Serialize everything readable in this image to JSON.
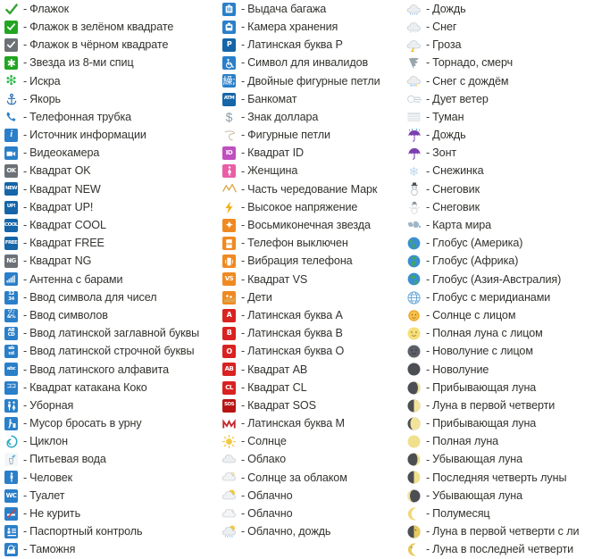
{
  "page": {
    "title": "Emoji reference list (Russian)",
    "text_color": "#32322e",
    "background": "#ffffff",
    "columns": 3
  },
  "columns": [
    {
      "id": "column-1",
      "rows": [
        {
          "icon": "check-mark-icon",
          "dash": "-",
          "label": "Флажок"
        },
        {
          "icon": "white-heavy-check-mark-icon",
          "dash": "-",
          "label": "Флажок в зелёном квадрате"
        },
        {
          "icon": "ballot-box-with-check-icon",
          "dash": "-",
          "label": "Флажок в чёрном квадрате"
        },
        {
          "icon": "eight-spoked-asterisk-icon",
          "dash": "-",
          "label": "Звезда из 8-ми спиц"
        },
        {
          "icon": "sparkle-icon",
          "dash": "-",
          "label": "Искра"
        },
        {
          "icon": "anchor-icon",
          "dash": "-",
          "label": "Якорь"
        },
        {
          "icon": "telephone-receiver-icon",
          "dash": "-",
          "label": "Телефонная трубка"
        },
        {
          "icon": "information-source-icon",
          "dash": "-",
          "label": "Источник информации"
        },
        {
          "icon": "video-camera-icon",
          "dash": "-",
          "label": "Видеокамера"
        },
        {
          "icon": "squared-ok-icon",
          "dash": "-",
          "label": "Квадрат OK"
        },
        {
          "icon": "squared-new-icon",
          "dash": "-",
          "label": "Квадрат NEW"
        },
        {
          "icon": "squared-up-icon",
          "dash": "-",
          "label": "Квадрат UP!"
        },
        {
          "icon": "squared-cool-icon",
          "dash": "-",
          "label": "Квадрат COOL"
        },
        {
          "icon": "squared-free-icon",
          "dash": "-",
          "label": "Квадрат FREE"
        },
        {
          "icon": "squared-ng-icon",
          "dash": "-",
          "label": "Квадрат NG"
        },
        {
          "icon": "antenna-with-bars-icon",
          "dash": "-",
          "label": "Антенна с барами"
        },
        {
          "icon": "input-numbers-icon",
          "dash": "-",
          "label": "Ввод символа для чисел"
        },
        {
          "icon": "input-symbols-icon",
          "dash": "-",
          "label": "Ввод символов"
        },
        {
          "icon": "input-latin-uppercase-icon",
          "dash": "-",
          "label": "Ввод латинской заглавной буквы"
        },
        {
          "icon": "input-latin-lowercase-icon",
          "dash": "-",
          "label": "Ввод латинской строчной буквы"
        },
        {
          "icon": "input-latin-letters-icon",
          "dash": "-",
          "label": "Ввод латинского алфавита"
        },
        {
          "icon": "squared-katakana-koko-icon",
          "dash": "-",
          "label": "Квадрат катакана Коко"
        },
        {
          "icon": "restroom-icon",
          "dash": "-",
          "label": "Уборная"
        },
        {
          "icon": "put-litter-in-bin-icon",
          "dash": "-",
          "label": "Мусор бросать в урну"
        },
        {
          "icon": "cyclone-icon",
          "dash": "-",
          "label": "Циклон"
        },
        {
          "icon": "potable-water-icon",
          "dash": "-",
          "label": "Питьевая вода"
        },
        {
          "icon": "pedestrian-icon",
          "dash": "-",
          "label": "Человек"
        },
        {
          "icon": "water-closet-icon",
          "dash": "-",
          "label": "Туалет"
        },
        {
          "icon": "no-smoking-icon",
          "dash": "-",
          "label": "Не курить"
        },
        {
          "icon": "passport-control-icon",
          "dash": "-",
          "label": "Паспортный контроль"
        },
        {
          "icon": "customs-icon",
          "dash": "-",
          "label": "Таможня"
        }
      ]
    },
    {
      "id": "column-2",
      "rows": [
        {
          "icon": "baggage-claim-icon",
          "dash": "-",
          "label": "Выдача багажа"
        },
        {
          "icon": "left-luggage-icon",
          "dash": "-",
          "label": "Камера хранения"
        },
        {
          "icon": "negative-squared-latin-p-icon",
          "dash": "-",
          "label": "Латинская буква P"
        },
        {
          "icon": "wheelchair-symbol-icon",
          "dash": "-",
          "label": "Символ для инвалидов"
        },
        {
          "icon": "double-curly-loop-icon",
          "dash": "-",
          "label": "Двойные фигурные петли"
        },
        {
          "icon": "automated-teller-machine-icon",
          "dash": "-",
          "label": "Банкомат"
        },
        {
          "icon": "heavy-dollar-sign-icon",
          "dash": "-",
          "label": "Знак доллара"
        },
        {
          "icon": "curly-loop-icon",
          "dash": "-",
          "label": "Фигурные петли"
        },
        {
          "icon": "squared-id-icon",
          "dash": "-",
          "label": "Квадрат ID"
        },
        {
          "icon": "womens-symbol-icon",
          "dash": "-",
          "label": "Женщина"
        },
        {
          "icon": "part-alternation-mark-icon",
          "dash": "-",
          "label": "Часть чередование Марк"
        },
        {
          "icon": "high-voltage-sign-icon",
          "dash": "-",
          "label": "Высокое напряжение"
        },
        {
          "icon": "eight-pointed-black-star-icon",
          "dash": "-",
          "label": "Восьмиконечная звезда"
        },
        {
          "icon": "mobile-phone-off-icon",
          "dash": "-",
          "label": "Телефон выключен"
        },
        {
          "icon": "vibration-mode-icon",
          "dash": "-",
          "label": "Вибрация телефона"
        },
        {
          "icon": "squared-vs-icon",
          "dash": "-",
          "label": "Квадрат VS"
        },
        {
          "icon": "children-crossing-icon",
          "dash": "-",
          "label": "Дети"
        },
        {
          "icon": "negative-squared-latin-a-icon",
          "dash": "-",
          "label": "Латинская буква A"
        },
        {
          "icon": "negative-squared-latin-b-icon",
          "dash": "-",
          "label": "Латинская буква B"
        },
        {
          "icon": "negative-squared-latin-o-icon",
          "dash": "-",
          "label": "Латинская буква O"
        },
        {
          "icon": "negative-squared-ab-icon",
          "dash": "-",
          "label": "Квадрат AB"
        },
        {
          "icon": "squared-cl-icon",
          "dash": "-",
          "label": "Квадрат CL"
        },
        {
          "icon": "squared-sos-icon",
          "dash": "-",
          "label": "Квадрат SOS"
        },
        {
          "icon": "circled-latin-m-icon",
          "dash": "-",
          "label": "Латинская буква M"
        },
        {
          "icon": "black-sun-with-rays-icon",
          "dash": "-",
          "label": "Солнце"
        },
        {
          "icon": "cloud-icon",
          "dash": "-",
          "label": "Облако"
        },
        {
          "icon": "white-sun-behind-cloud-icon",
          "dash": "-",
          "label": "Солнце за облаком"
        },
        {
          "icon": "sun-behind-small-cloud-icon",
          "dash": "-",
          "label": "Облачно"
        },
        {
          "icon": "sun-behind-large-cloud-icon",
          "dash": "-",
          "label": "Облачно"
        },
        {
          "icon": "sun-behind-rain-cloud-icon",
          "dash": "-",
          "label": "Облачно, дождь"
        }
      ]
    },
    {
      "id": "column-3",
      "rows": [
        {
          "icon": "cloud-with-rain-icon",
          "dash": "-",
          "label": "Дождь"
        },
        {
          "icon": "cloud-with-snow-icon",
          "dash": "-",
          "label": "Снег"
        },
        {
          "icon": "cloud-with-lightning-icon",
          "dash": "-",
          "label": "Гроза"
        },
        {
          "icon": "tornado-icon",
          "dash": "-",
          "label": "Торнадо, смерч"
        },
        {
          "icon": "cloud-with-snow-and-rain-icon",
          "dash": "-",
          "label": "Снег с дождём"
        },
        {
          "icon": "wind-blowing-face-icon",
          "dash": "-",
          "label": "Дует ветер"
        },
        {
          "icon": "fog-icon",
          "dash": "-",
          "label": "Туман"
        },
        {
          "icon": "umbrella-with-rain-drops-icon",
          "dash": "-",
          "label": "Дождь"
        },
        {
          "icon": "umbrella-icon",
          "dash": "-",
          "label": "Зонт"
        },
        {
          "icon": "snowflake-icon",
          "dash": "-",
          "label": "Снежинка"
        },
        {
          "icon": "snowman-icon",
          "dash": "-",
          "label": "Снеговик"
        },
        {
          "icon": "snowman-without-snow-icon",
          "dash": "-",
          "label": "Снеговик"
        },
        {
          "icon": "world-map-icon",
          "dash": "-",
          "label": "Карта мира"
        },
        {
          "icon": "earth-globe-americas-icon",
          "dash": "-",
          "label": "Глобус (Америка)"
        },
        {
          "icon": "earth-globe-europe-africa-icon",
          "dash": "-",
          "label": "Глобус (Африка)"
        },
        {
          "icon": "earth-globe-asia-australia-icon",
          "dash": "-",
          "label": "Глобус (Азия-Австралия)"
        },
        {
          "icon": "globe-with-meridians-icon",
          "dash": "-",
          "label": "Глобус с меридианами"
        },
        {
          "icon": "sun-with-face-icon",
          "dash": "-",
          "label": "Солнце с лицом"
        },
        {
          "icon": "full-moon-with-face-icon",
          "dash": "-",
          "label": "Полная луна с лицом"
        },
        {
          "icon": "new-moon-with-face-icon",
          "dash": "-",
          "label": "Новолуние с лицом"
        },
        {
          "icon": "new-moon-icon",
          "dash": "-",
          "label": "Новолуние"
        },
        {
          "icon": "waxing-crescent-moon-icon",
          "dash": "-",
          "label": "Прибывающая луна"
        },
        {
          "icon": "first-quarter-moon-icon",
          "dash": "-",
          "label": "Луна в первой четверти"
        },
        {
          "icon": "waxing-gibbous-moon-icon",
          "dash": "-",
          "label": "Прибывающая луна"
        },
        {
          "icon": "full-moon-icon",
          "dash": "-",
          "label": "Полная луна"
        },
        {
          "icon": "waning-gibbous-moon-icon",
          "dash": "-",
          "label": "Убывающая луна"
        },
        {
          "icon": "last-quarter-moon-icon",
          "dash": "-",
          "label": "Последняя четверть луны"
        },
        {
          "icon": "waning-crescent-moon-icon",
          "dash": "-",
          "label": "Убывающая луна"
        },
        {
          "icon": "crescent-moon-icon",
          "dash": "-",
          "label": "Полумесяц"
        },
        {
          "icon": "first-quarter-moon-with-face-icon",
          "dash": "-",
          "label": "Луна в первой четверти с ли"
        },
        {
          "icon": "last-quarter-moon-with-face-icon",
          "dash": "-",
          "label": "Луна в последней четверти"
        }
      ]
    }
  ]
}
